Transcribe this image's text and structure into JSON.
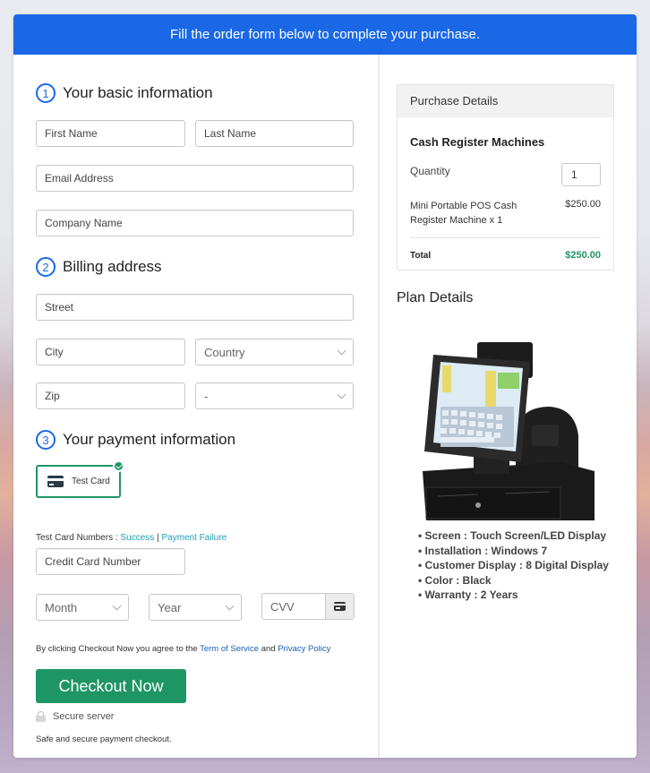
{
  "banner": {
    "text": "Fill the order form below to complete your purchase."
  },
  "sections": {
    "basic": {
      "number": "1",
      "title": "Your basic information"
    },
    "billing": {
      "number": "2",
      "title": "Billing address"
    },
    "payment": {
      "number": "3",
      "title": "Your payment information"
    }
  },
  "fields": {
    "first_name": {
      "placeholder": "First Name"
    },
    "last_name": {
      "placeholder": "Last Name"
    },
    "email": {
      "placeholder": "Email Address"
    },
    "company": {
      "placeholder": "Company Name"
    },
    "street": {
      "placeholder": "Street"
    },
    "city": {
      "placeholder": "City"
    },
    "country": {
      "selected": "Country"
    },
    "zip": {
      "placeholder": "Zip"
    },
    "state": {
      "selected": "-"
    },
    "card_number": {
      "placeholder": "Credit Card Number"
    },
    "month": {
      "selected": "Month"
    },
    "year": {
      "selected": "Year"
    },
    "cvv": {
      "placeholder": "CVV"
    }
  },
  "payment": {
    "method_label": "Test Card",
    "test_numbers_label": "Test Card Numbers : ",
    "success_link": "Success",
    "separator": " | ",
    "failure_link": "Payment Failure"
  },
  "terms": {
    "prefix": "By clicking Checkout Now you agree to the ",
    "tos_link": "Term of Service",
    "and": " and ",
    "privacy_link": "Privacy Policy"
  },
  "checkout_button": "Checkout Now",
  "secure_label": "Secure server",
  "safe_text": "Safe and secure payment checkout.",
  "purchase": {
    "header": "Purchase Details",
    "product_title": "Cash Register Machines",
    "quantity_label": "Quantity",
    "quantity_value": "1",
    "item_name": "Mini Portable POS Cash Register Machine x 1",
    "item_price": "$250.00",
    "total_label": "Total",
    "total_value": "$250.00"
  },
  "plan": {
    "title": "Plan Details",
    "image_alt": "POS cash register machine",
    "features": [
      "Screen : Touch Screen/LED Display",
      "Installation : Windows 7",
      "Customer Display : 8 Digital Display",
      "Color : Black",
      "Warranty : 2 Years"
    ]
  },
  "colors": {
    "banner": "#1a68e6",
    "accent_green": "#1e9564",
    "link_teal": "#1a9fb5",
    "link_blue": "#1a5fb4"
  }
}
